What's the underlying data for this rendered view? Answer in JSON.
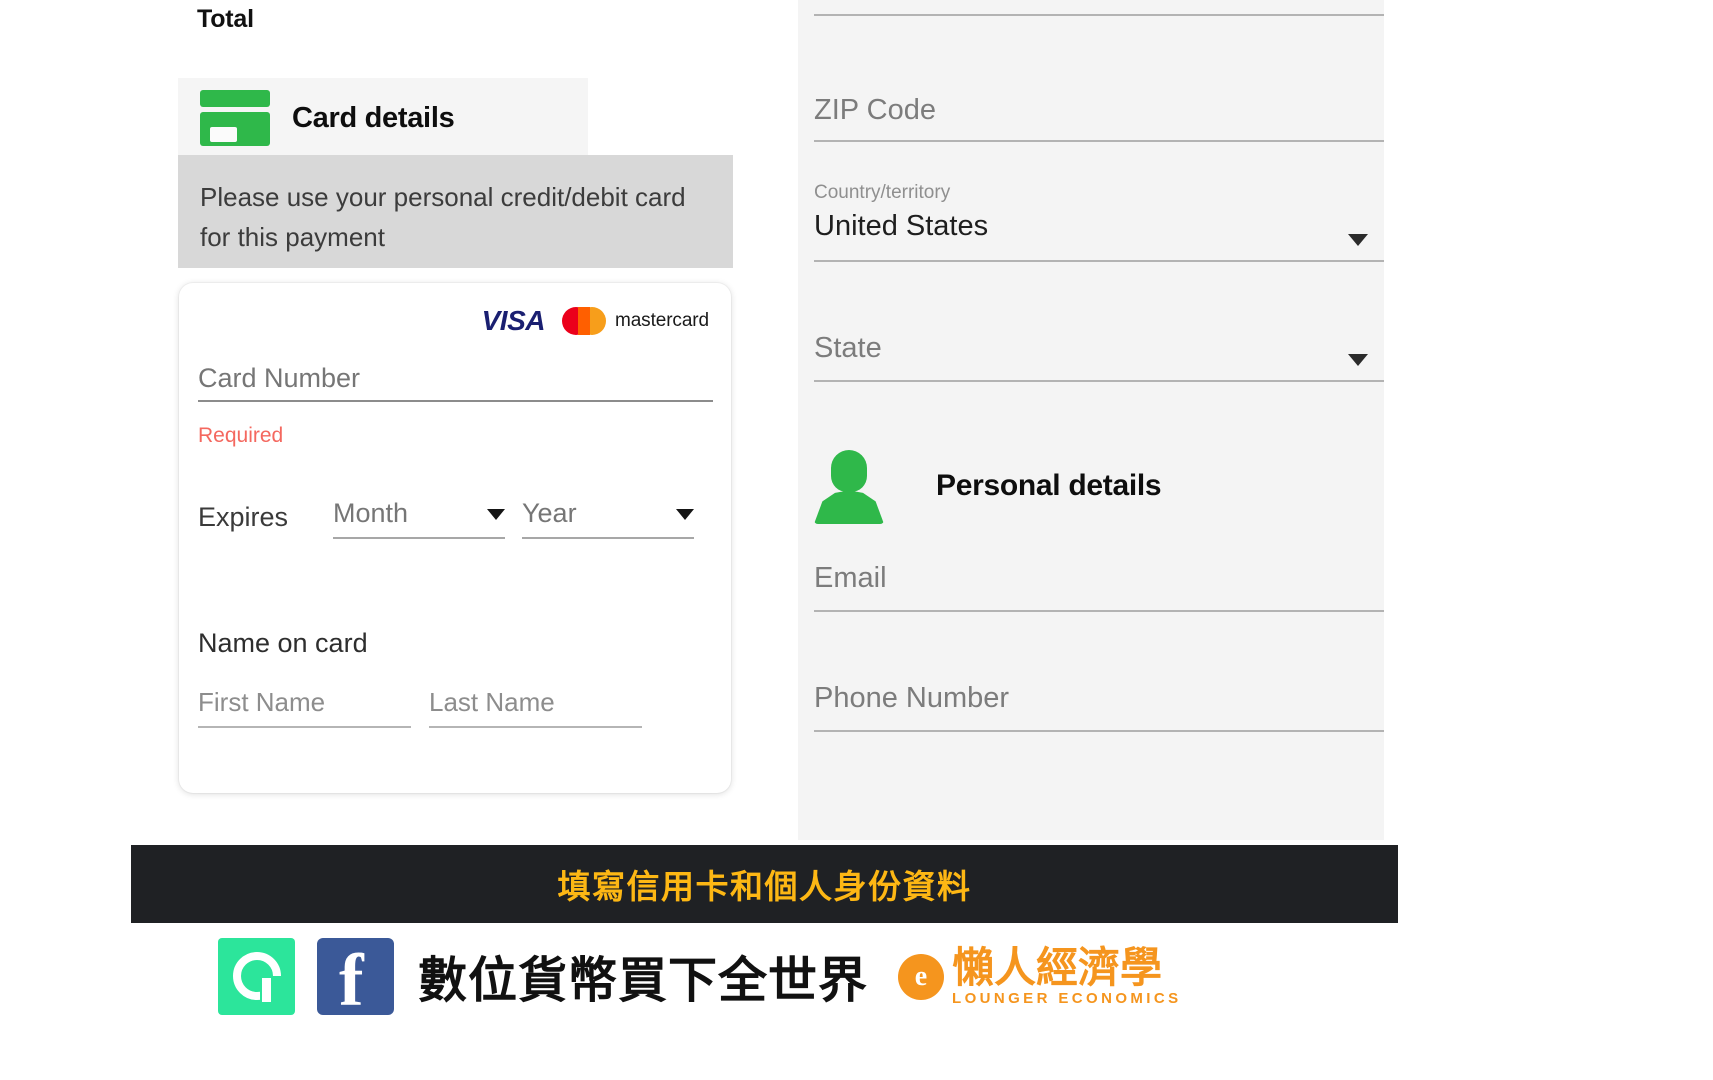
{
  "left": {
    "total_label": "Total",
    "card_section": {
      "icon": "credit-card-icon",
      "title": "Card details",
      "notice": "Please use your personal credit/debit card for this payment",
      "brands": [
        {
          "name": "visa-logo",
          "label": "VISA"
        },
        {
          "name": "mastercard-logo",
          "label": "mastercard"
        }
      ],
      "card_number": {
        "placeholder": "Card Number",
        "value": "",
        "error": "Required"
      },
      "expires": {
        "label": "Expires",
        "month": {
          "placeholder": "Month",
          "value": ""
        },
        "year": {
          "placeholder": "Year",
          "value": ""
        }
      },
      "name_on_card": {
        "label": "Name on card",
        "first": {
          "placeholder": "First Name",
          "value": ""
        },
        "last": {
          "placeholder": "Last Name",
          "value": ""
        }
      }
    }
  },
  "right": {
    "zip": {
      "placeholder": "ZIP Code",
      "value": ""
    },
    "country": {
      "label": "Country/territory",
      "value": "United States"
    },
    "state": {
      "placeholder": "State",
      "value": ""
    },
    "personal_section": {
      "icon": "person-icon",
      "title": "Personal details",
      "email": {
        "placeholder": "Email",
        "value": ""
      },
      "phone": {
        "placeholder": "Phone Number",
        "value": ""
      }
    }
  },
  "banner": {
    "text": "填寫信用卡和個人身份資料"
  },
  "footer": {
    "app_icon": "app-logo-icon",
    "facebook_icon": "facebook-icon",
    "headline": "數位貨幣買下全世界",
    "brand": {
      "badge_glyph": "e",
      "name_cn": "懶人經濟學",
      "name_en": "LOUNGER ECONOMICS"
    }
  },
  "colors": {
    "accent_green": "#2fb84a",
    "error_red": "#f4685f",
    "banner_bg": "#1f2124",
    "banner_text": "#fdb714",
    "brand_orange": "#f5951e",
    "facebook_blue": "#3b5998",
    "app_green": "#2ce59b",
    "visa_navy": "#1a1f71",
    "mc_red": "#eb001b",
    "mc_orange": "#f79e1b",
    "panel_gray": "#f4f4f4",
    "notice_gray": "#d8d8d8"
  }
}
